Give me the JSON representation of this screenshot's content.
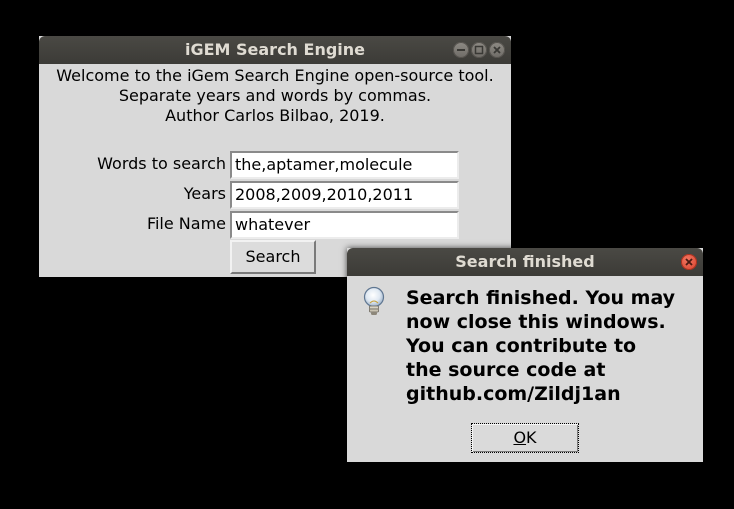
{
  "main_window": {
    "title": "iGEM Search Engine",
    "intro_lines": [
      "Welcome to the iGem Search Engine open-source tool.",
      "Separate years and words by commas.",
      "Author Carlos Bilbao, 2019."
    ],
    "fields": {
      "words": {
        "label": "Words to search",
        "value": "the,aptamer,molecule"
      },
      "years": {
        "label": "Years",
        "value": "2008,2009,2010,2011"
      },
      "file": {
        "label": "File Name",
        "value": "whatever"
      }
    },
    "search_button": "Search",
    "titlebar_buttons": [
      "minimize-icon",
      "maximize-icon",
      "close-icon"
    ]
  },
  "dialog": {
    "title": "Search finished",
    "icon": "lightbulb-icon",
    "message_lines": [
      "Search finished. You may",
      "now close this windows.",
      "You can contribute to",
      "the source code at",
      "github.com/Zildj1an"
    ],
    "ok_button": {
      "underlined": "O",
      "rest": "K"
    },
    "close_color": "#df4a2f"
  }
}
